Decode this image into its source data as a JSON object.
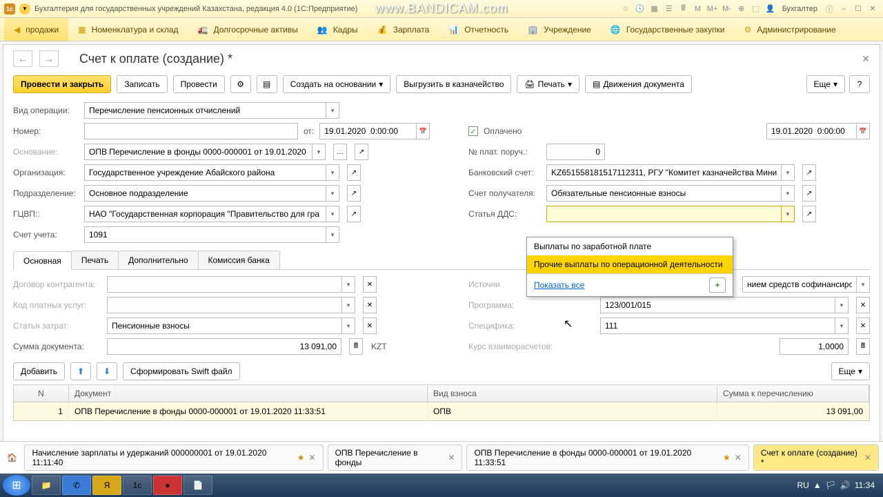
{
  "titlebar": {
    "app_title": "Бухгалтерия для государственных учреждений Казахстана, редакция 4.0  (1С:Предприятие)",
    "user": "Бухгалтер",
    "watermark": "www.BANDICAM.com"
  },
  "main_menu": {
    "items": [
      {
        "label": "продажи",
        "icon": "arrow"
      },
      {
        "label": "Номенклатура и склад",
        "icon": "grid"
      },
      {
        "label": "Долгосрочные активы",
        "icon": "truck"
      },
      {
        "label": "Кадры",
        "icon": "people"
      },
      {
        "label": "Зарплата",
        "icon": "money"
      },
      {
        "label": "Отчетность",
        "icon": "chart"
      },
      {
        "label": "Учреждение",
        "icon": "building"
      },
      {
        "label": "Государственные закупки",
        "icon": "globe"
      },
      {
        "label": "Администрирование",
        "icon": "gear"
      }
    ]
  },
  "page": {
    "title": "Счет к оплате (создание) *"
  },
  "toolbar": {
    "primary": "Провести и закрыть",
    "zapisat": "Записать",
    "provesti": "Провести",
    "sozdat": "Создать на основании",
    "vygruzit": "Выгрузить в казначейство",
    "pechat": "Печать",
    "dvizheniya": "Движения документа",
    "eshe": "Еще",
    "help": "?"
  },
  "form": {
    "vid_operacii_lbl": "Вид операции:",
    "vid_operacii": "Перечисление пенсионных отчислений",
    "nomer_lbl": "Номер:",
    "nomer": "",
    "ot_lbl": "от:",
    "date1": "19.01.2020  0:00:00",
    "oplacheno_lbl": "Оплачено",
    "date2": "19.01.2020  0:00:00",
    "osnovanie_lbl": "Основание:",
    "osnovanie": "ОПВ Перечисление в фонды 0000-000001 от 19.01.2020",
    "noplat_lbl": "№ плат. поруч.:",
    "noplat": "0",
    "org_lbl": "Организация:",
    "org": "Государственное учреждение Абайского района",
    "bank_lbl": "Банковский счет:",
    "bank": "KZ651558181517112311, РГУ \"Комитет казначейства Минист",
    "podr_lbl": "Подразделение:",
    "podr": "Основное подразделение",
    "schet_pol_lbl": "Счет получателя:",
    "schet_pol": "Обязательные пенсионные взносы",
    "gcvp_lbl": "ГЦВП::",
    "gcvp": "НАО \"Государственная корпорация \"Правительство для гра",
    "dds_lbl": "Статья ДДС:",
    "dds": "",
    "schet_uch_lbl": "Счет учета:",
    "schet_uch": "1091"
  },
  "dds_dropdown": {
    "opt1": "Выплаты по заработной плате",
    "opt2": "Прочие выплаты по операционной деятельности",
    "show_all": "Показать все"
  },
  "tabs_form": {
    "t1": "Основная",
    "t2": "Печать",
    "t3": "Дополнительно",
    "t4": "Комиссия банка"
  },
  "subform": {
    "dogovor_lbl": "Договор контрагента:",
    "dogovor": "",
    "istoch_lbl": "Источни",
    "istoch_val": "нием средств софинансирова",
    "kod_lbl": "Код платных услуг:",
    "kod": "",
    "prog_lbl": "Программа:",
    "prog": "123/001/015",
    "stat_lbl": "Статья затрат:",
    "stat": "Пенсионные взносы",
    "spec_lbl": "Специфика:",
    "spec": "111",
    "summa_lbl": "Сумма документа:",
    "summa": "13 091,00",
    "currency": "KZT",
    "kurs_lbl": "Курс взаиморасчетов:",
    "kurs": "1,0000"
  },
  "table_toolbar": {
    "dobavit": "Добавить",
    "swift": "Сформировать Swift файл",
    "eshe": "Еще"
  },
  "table": {
    "headers": {
      "n": "N",
      "doc": "Документ",
      "vid": "Вид взноса",
      "summa": "Сумма к перечислению"
    },
    "row1": {
      "n": "1",
      "doc": "ОПВ Перечисление в фонды 0000-000001 от 19.01.2020 11:33:51",
      "vid": "ОПВ",
      "summa": "13 091,00"
    }
  },
  "bottom_tabs": {
    "t1": "Начисление зарплаты и удержаний 000000001 от 19.01.2020 11:11:40",
    "t2": "ОПВ Перечисление в фонды",
    "t3": "ОПВ Перечисление в фонды 0000-000001 от 19.01.2020 11:33:51",
    "t4": "Счет к оплате (создание) *"
  },
  "taskbar": {
    "lang": "RU",
    "time": "11:34"
  }
}
